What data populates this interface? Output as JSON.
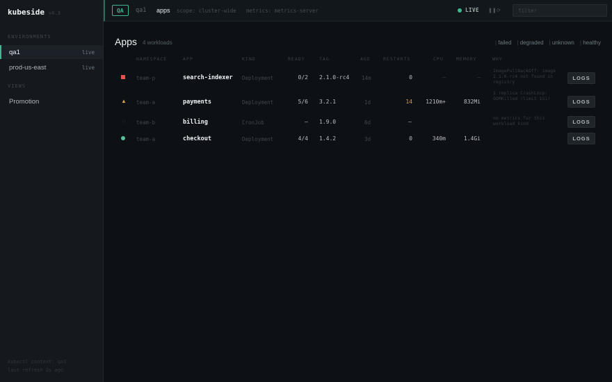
{
  "brand": {
    "name": "kubeside",
    "version": "v0.3"
  },
  "sidebar": {
    "environments_title": "ENVIRONMENTS",
    "environments": [
      {
        "label": "qa1",
        "badge": "live",
        "active": true
      },
      {
        "label": "prod-us-east",
        "badge": "live",
        "active": false
      }
    ],
    "views_title": "VIEWS",
    "views": [
      {
        "label": "Promotion"
      }
    ],
    "footer": [
      "kubectl context: qa1",
      "last refresh 2s ago"
    ]
  },
  "topbar": {
    "env_chip": "QA",
    "crumb_env": "qa1",
    "crumb_page": "apps",
    "scope": "scope: cluster-wide",
    "metrics": "metrics: metrics-server",
    "live_label": "LIVE",
    "search_placeholder": "filter",
    "icons": [
      "pause-icon",
      "refresh-icon"
    ]
  },
  "main": {
    "title": "Apps",
    "subtitle": "4 workloads",
    "filters": [
      "failed",
      "degraded",
      "unknown",
      "healthy"
    ],
    "columns": [
      "NAMESPACE",
      "APP",
      "KIND",
      "READY",
      "TAG",
      "AGE",
      "RESTARTS",
      "CPU",
      "MEMORY",
      "WHY"
    ],
    "rows": [
      {
        "status": "failed",
        "namespace": "team-p",
        "app": "search-indexer",
        "kind": "Deployment",
        "ready": "0/2",
        "tag": "2.1.0-rc4",
        "age": "14m",
        "restarts": "0",
        "cpu": "—",
        "memory": "—",
        "why": "ImagePullBackOff: image 2.1.0-rc4 not found in registry",
        "logs": "LOGS"
      },
      {
        "status": "degraded",
        "namespace": "team-a",
        "app": "payments",
        "kind": "Deployment",
        "ready": "5/6",
        "tag": "3.2.1",
        "age": "1d",
        "restarts": "14",
        "cpu": "1210m+",
        "memory": "832Mi",
        "why": "1 replica CrashLoop: OOMKilled (limit 1Gi)",
        "logs": "LOGS"
      },
      {
        "status": "unknown",
        "namespace": "team-b",
        "app": "billing",
        "kind": "CronJob",
        "ready": "—",
        "tag": "1.9.0",
        "age": "6d",
        "restarts": "—",
        "cpu": "",
        "memory": "",
        "why": "no metrics for this workload kind",
        "logs": "LOGS"
      },
      {
        "status": "healthy",
        "namespace": "team-a",
        "app": "checkout",
        "kind": "Deployment",
        "ready": "4/4",
        "tag": "1.4.2",
        "age": "3d",
        "restarts": "0",
        "cpu": "340m",
        "memory": "1.4Gi",
        "why": "",
        "logs": "LOGS"
      }
    ]
  },
  "colors": {
    "accent": "#3fb991",
    "failed": "#e5534b",
    "warning": "#d4a14a",
    "background": "#0d1115"
  }
}
